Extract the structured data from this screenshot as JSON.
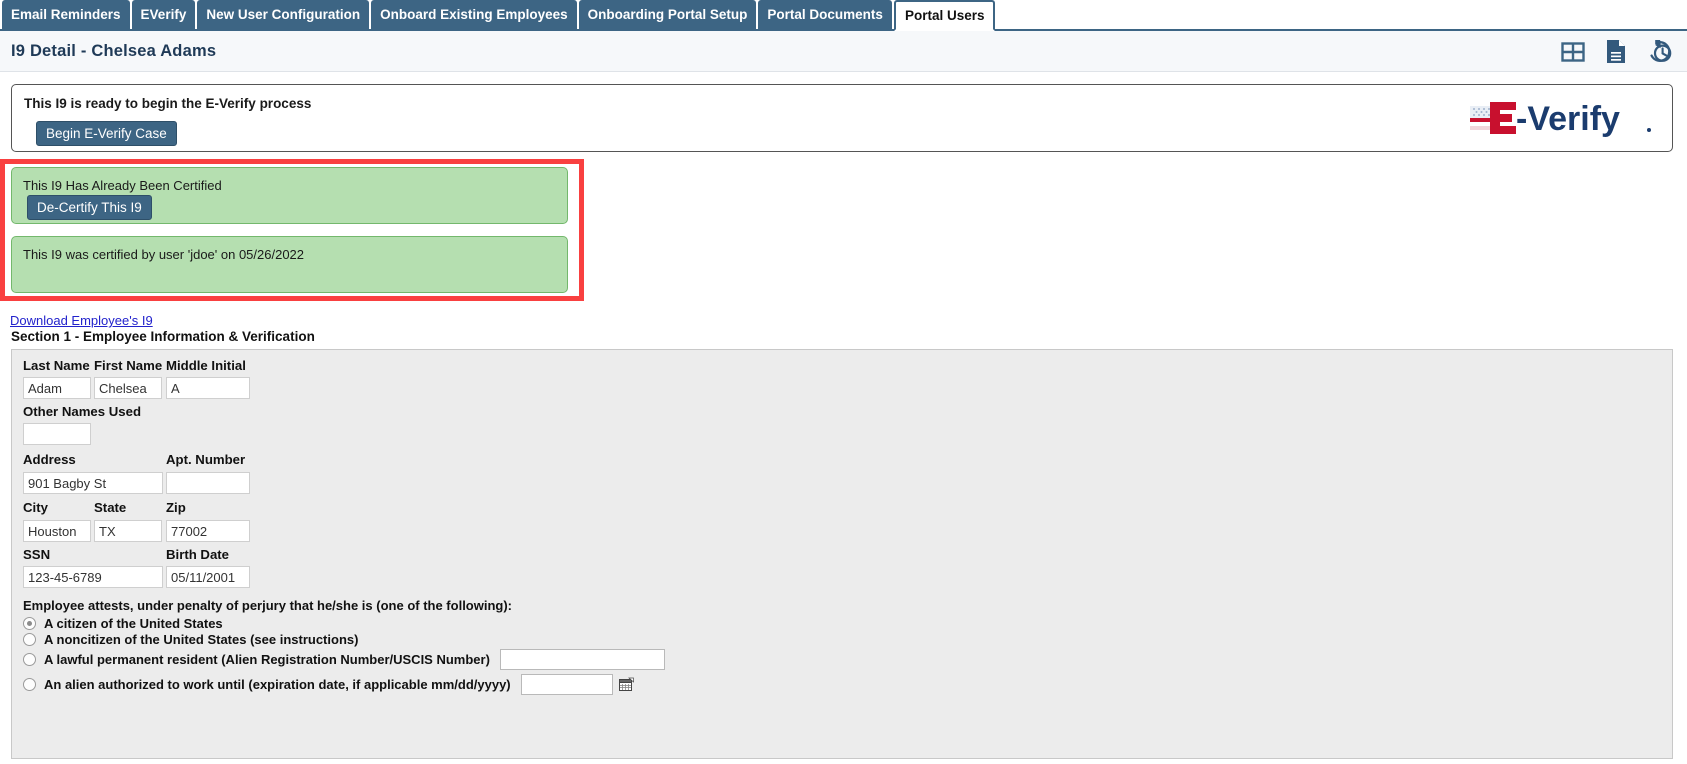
{
  "tabs": [
    {
      "label": "Email Reminders",
      "active": false
    },
    {
      "label": "EVerify",
      "active": false
    },
    {
      "label": "New User Configuration",
      "active": false
    },
    {
      "label": "Onboard Existing Employees",
      "active": false
    },
    {
      "label": "Onboarding Portal Setup",
      "active": false
    },
    {
      "label": "Portal Documents",
      "active": false
    },
    {
      "label": "Portal Users",
      "active": true
    }
  ],
  "header": {
    "title": "I9 Detail - Chelsea Adams",
    "icons": [
      {
        "name": "grid-view-icon"
      },
      {
        "name": "document-icon"
      },
      {
        "name": "history-icon"
      }
    ]
  },
  "everify": {
    "message": "This I9 is ready to begin the E-Verify process",
    "begin_button": "Begin E-Verify Case",
    "logo_e": "E",
    "logo_dash": "-",
    "logo_verify": "Verify"
  },
  "certification": {
    "already_certified_text": "This I9 Has Already Been Certified",
    "decertify_button": "De-Certify This I9",
    "certified_by_text": "This I9 was certified by user 'jdoe' on 05/26/2022"
  },
  "download_link": "Download Employee's I9",
  "section1": {
    "title": "Section 1 - Employee Information & Verification",
    "labels": {
      "last_name": "Last Name",
      "first_name": "First Name",
      "middle_initial": "Middle Initial",
      "other_names": "Other Names Used",
      "address": "Address",
      "apt_number": "Apt. Number",
      "city": "City",
      "state": "State",
      "zip": "Zip",
      "ssn": "SSN",
      "birth_date": "Birth Date"
    },
    "values": {
      "last_name": "Adam",
      "first_name": "Chelsea",
      "middle_initial": "A",
      "other_names": "",
      "address": "901 Bagby St",
      "apt_number": "",
      "city": "Houston",
      "state": "TX",
      "zip": "77002",
      "ssn": "123-45-6789",
      "birth_date": "05/11/2001"
    },
    "attestation": {
      "heading": "Employee attests, under penalty of perjury that he/she is (one of the following):",
      "options": [
        {
          "label": "A citizen of the United States",
          "selected": true
        },
        {
          "label": "A noncitizen of the United States (see instructions)",
          "selected": false
        },
        {
          "label": "A lawful permanent resident (Alien Registration Number/USCIS Number)",
          "selected": false,
          "value": ""
        },
        {
          "label": "An alien authorized to work until (expiration date, if applicable mm/dd/yyyy)",
          "selected": false,
          "value": ""
        }
      ]
    }
  },
  "colors": {
    "tab_blue": "#3d6584",
    "highlight_red": "#f94040",
    "banner_green": "#b5dfb0",
    "banner_green_border": "#73b86c",
    "link_blue": "#2222cc",
    "everify_red": "#c8102e",
    "everify_navy": "#1b3c6e"
  }
}
